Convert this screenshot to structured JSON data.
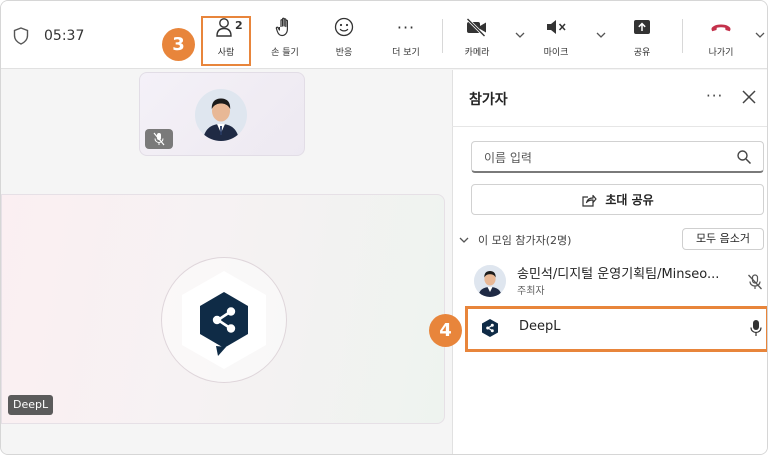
{
  "meeting": {
    "elapsed_time": "05:37"
  },
  "toolbar": {
    "people": {
      "label": "사람",
      "count": "2"
    },
    "raise_hand": {
      "label": "손 들기"
    },
    "react": {
      "label": "반응"
    },
    "more": {
      "label": "더 보기",
      "glyph": "···"
    },
    "camera": {
      "label": "카메라"
    },
    "mic": {
      "label": "마이크"
    },
    "share": {
      "label": "공유"
    },
    "leave": {
      "label": "나가기"
    }
  },
  "annotations": [
    {
      "number": "3"
    },
    {
      "number": "4"
    }
  ],
  "stage": {
    "main_tile_name": "DeepL"
  },
  "panel": {
    "title": "참가자",
    "more_glyph": "···",
    "search_placeholder": "이름 입력",
    "invite_label": "초대 공유",
    "group_label": "이 모임 참가자(2명)",
    "mute_all_label": "모두 음소거",
    "participants": [
      {
        "name": "송민석/디지털 운영기획팀/Minseo...",
        "role": "주최자",
        "mic": "muted"
      },
      {
        "name": "DeepL",
        "mic": "on"
      }
    ]
  },
  "colors": {
    "annotation": "#e8853b",
    "leave_red": "#c4314b",
    "deepl_navy": "#0f2b46"
  },
  "icons": [
    "shield-icon",
    "people-icon",
    "hand-icon",
    "smile-icon",
    "more-icon",
    "camera-off-icon",
    "mic-off-icon",
    "share-icon",
    "leave-phone-icon",
    "chevron-down-icon",
    "close-icon",
    "search-icon",
    "share-invite-icon",
    "mic-icon",
    "deepl-logo"
  ]
}
